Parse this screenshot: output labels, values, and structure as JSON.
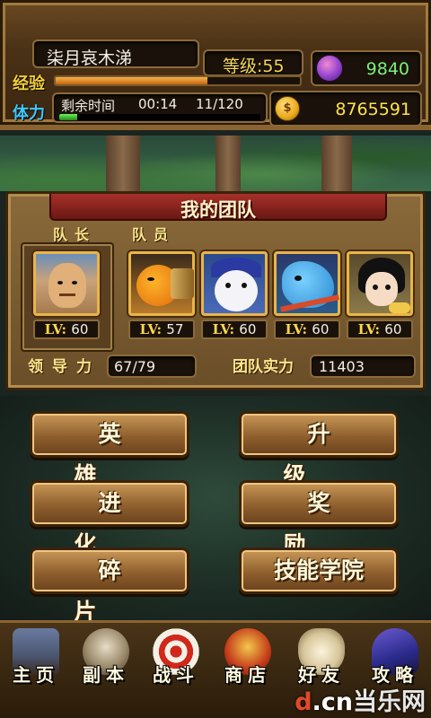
{
  "player": {
    "name": "柒月哀木涕",
    "level_text": "等级:55",
    "exp_label": "经验",
    "exp_progress": 0.62,
    "stamina_label": "体力",
    "stamina_remaining_label": "剩余时间",
    "stamina_time": "00:14",
    "stamina_count": "11/120",
    "stamina_progress": 0.09,
    "gems": "9840",
    "gold": "8765591",
    "gold_icon_glyph": "$"
  },
  "team": {
    "title": "我的团队",
    "captain_label": "队长",
    "members_label": "队员",
    "captain": {
      "lv_prefix": "LV:",
      "level": "60",
      "icon": "bald-man-portrait"
    },
    "members": [
      {
        "lv_prefix": "LV:",
        "level": "57",
        "icon": "orange-beast-portrait"
      },
      {
        "lv_prefix": "LV:",
        "level": "60",
        "icon": "white-ghost-portrait"
      },
      {
        "lv_prefix": "LV:",
        "level": "60",
        "icon": "blue-fish-warrior-portrait"
      },
      {
        "lv_prefix": "LV:",
        "level": "60",
        "icon": "black-hair-girl-portrait"
      }
    ],
    "leadership_label": "领导力",
    "leadership_value": "67/79",
    "power_label": "团队实力",
    "power_value": "11403"
  },
  "menu": {
    "heroes": "英雄",
    "upgrade": "升级",
    "evolve": "进化",
    "rewards": "奖励",
    "fragments": "碎片",
    "skill_academy": "技能学院"
  },
  "nav": [
    {
      "label": "主页",
      "icon": "castle-icon"
    },
    {
      "label": "副本",
      "icon": "skull-icon"
    },
    {
      "label": "战斗",
      "icon": "target-icon"
    },
    {
      "label": "商店",
      "icon": "shop-icon"
    },
    {
      "label": "好友",
      "icon": "wings-icon"
    },
    {
      "label": "攻略",
      "icon": "wizard-hat-icon"
    }
  ],
  "watermark": {
    "d": "d",
    "cn": ".cn",
    "brand": "当乐网"
  },
  "colors": {
    "exp_bar": "#e08a2a",
    "stamina_bar": "#4fd040",
    "gems_text": "#7bf07a",
    "gold_text": "#ffe34a",
    "title_red": "#8a2018"
  }
}
